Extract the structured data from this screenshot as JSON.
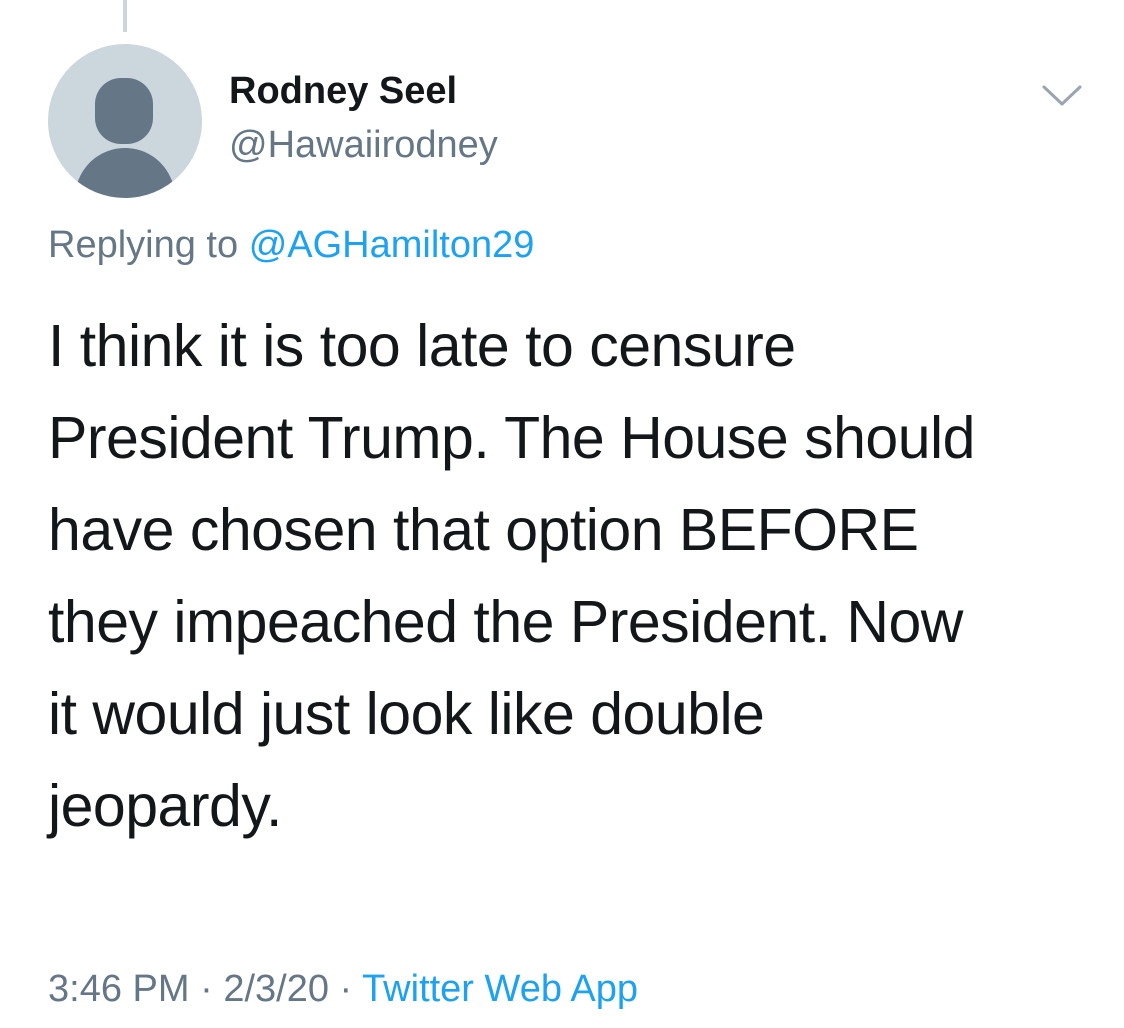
{
  "tweet": {
    "author_name": "Rodney Seel",
    "author_handle": "@Hawaiirodney",
    "replying_prefix": "Replying to",
    "replying_to": "@AGHamilton29",
    "text_lines": [
      "I think it is too late to censure",
      "President Trump. The House should",
      "have chosen that option BEFORE",
      "they impeached the President. Now",
      "it would just look like double",
      "jeopardy."
    ],
    "time": "3:46 PM",
    "separator": "·",
    "date": "2/3/20",
    "source": "Twitter Web App"
  },
  "icons": {
    "avatar": "default-profile-avatar-icon",
    "menu": "chevron-down-icon"
  },
  "colors": {
    "text": "#14171a",
    "secondary": "#657786",
    "link": "#1da1f2",
    "avatar_bg": "#ccd6dd",
    "avatar_fg": "#657786"
  }
}
